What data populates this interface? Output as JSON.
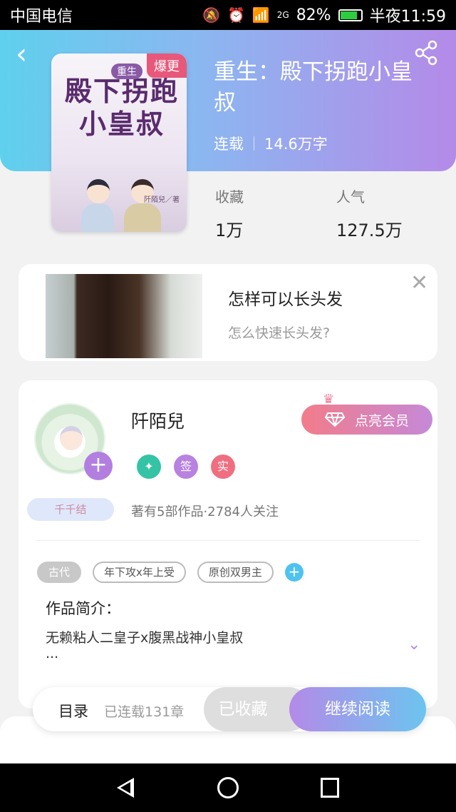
{
  "statusbar": {
    "carrier": "中国电信",
    "network": "2G",
    "battery": "82%",
    "battery_level": 0.82,
    "time": "半夜11:59"
  },
  "book": {
    "title": "重生：殿下拐跑小皇叔",
    "status": "连载",
    "word_count": "14.6万字",
    "cover_badge": "爆更",
    "cover_title": "殿下拐跑小皇叔",
    "cover_small": "重生",
    "cover_author": "阡陌兒／著",
    "stats": [
      {
        "label": "收藏",
        "value": "1万"
      },
      {
        "label": "人气",
        "value": "127.5万"
      }
    ]
  },
  "ad": {
    "title": "怎样可以长头发",
    "subtitle": "怎么快速长头发?"
  },
  "author": {
    "name": "阡陌兒",
    "vip_label": "点亮会员",
    "label": "千千结",
    "badges": [
      {
        "text": "",
        "color": "#35c3a6"
      },
      {
        "text": "签",
        "color": "#b782e0"
      },
      {
        "text": "实",
        "color": "#ef6f80"
      }
    ],
    "works": "著有5部作品·2784人关注"
  },
  "tags": [
    "古代",
    "年下攻x年上受",
    "原创双男主"
  ],
  "intro": {
    "label": "作品简介：",
    "text": "无赖粘人二皇子x腹黑战神小皇叔",
    "ellipsis": "..."
  },
  "actions": {
    "catalog": "目录",
    "chapters": "已连载131章",
    "collected": "已收藏",
    "continue": "继续阅读"
  },
  "icons": {
    "back": "back-arrow-icon",
    "share": "share-icon",
    "close": "close-icon",
    "plus": "plus-icon",
    "diamond": "diamond-icon",
    "crown": "crown-icon",
    "chevron": "chevron-down-icon"
  }
}
